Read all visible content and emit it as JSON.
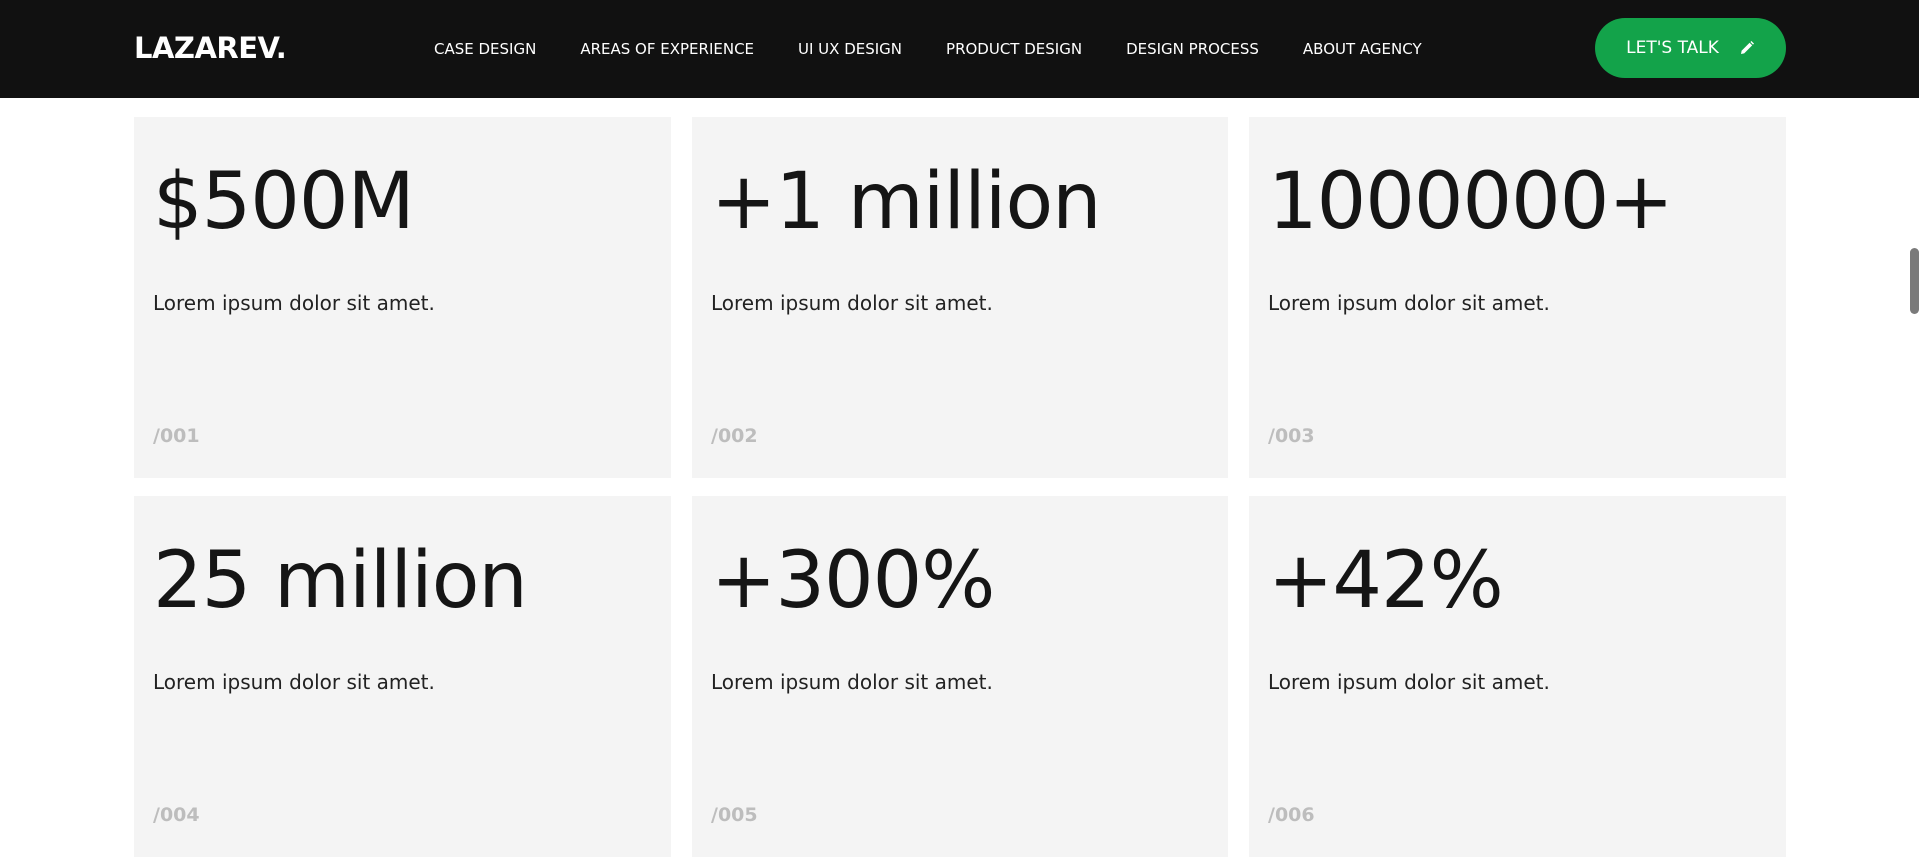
{
  "header": {
    "logo": "LAZAREV.",
    "nav": [
      {
        "label": "CASE DESIGN"
      },
      {
        "label": "AREAS OF EXPERIENCE"
      },
      {
        "label": "UI UX DESIGN"
      },
      {
        "label": "PRODUCT DESIGN"
      },
      {
        "label": "DESIGN PROCESS"
      },
      {
        "label": "ABOUT AGENCY"
      }
    ],
    "cta_label": "LET'S TALK",
    "cta_icon": "pencil-icon",
    "cta_color": "#13a34a",
    "background": "#111111"
  },
  "stats": [
    {
      "value": "$500M",
      "description": "Lorem ipsum dolor sit amet.",
      "index": "/001"
    },
    {
      "value": "+1 million",
      "description": "Lorem ipsum dolor sit amet.",
      "index": "/002"
    },
    {
      "value": "1000000+",
      "description": "Lorem ipsum dolor sit amet.",
      "index": "/003"
    },
    {
      "value": "25 million",
      "description": "Lorem ipsum dolor sit amet.",
      "index": "/004"
    },
    {
      "value": "+300%",
      "description": "Lorem ipsum dolor sit amet.",
      "index": "/005"
    },
    {
      "value": "+42%",
      "description": "Lorem ipsum dolor sit amet.",
      "index": "/006"
    }
  ],
  "colors": {
    "card_background": "#f4f4f4",
    "index_color": "#bdbdbd"
  }
}
